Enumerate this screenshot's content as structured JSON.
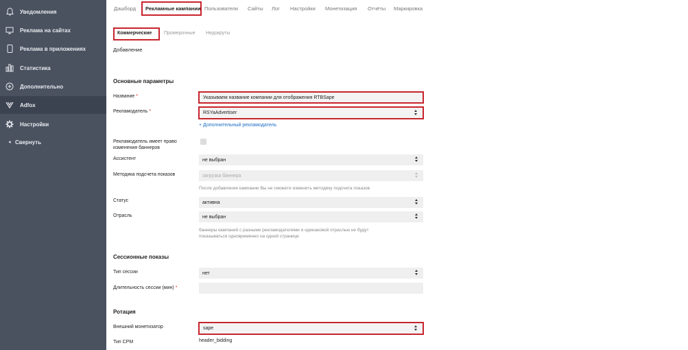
{
  "sidebar": {
    "items": [
      {
        "label": "Уведомления",
        "icon": "bell-icon"
      },
      {
        "label": "Реклама на сайтах",
        "icon": "monitor-icon"
      },
      {
        "label": "Реклама в приложениях",
        "icon": "phone-icon"
      },
      {
        "label": "Статистика",
        "icon": "chart-icon"
      },
      {
        "label": "Дополнительно",
        "icon": "plus-circle-icon"
      },
      {
        "label": "Adfox",
        "icon": "adfox-icon"
      },
      {
        "label": "Настройки",
        "icon": "gear-icon"
      },
      {
        "label": "Свернуть",
        "icon": "collapse-icon"
      }
    ],
    "active_index": 5
  },
  "topnav": {
    "items": [
      "Дашборд",
      "Рекламные кампании",
      "Пользователи",
      "Сайты",
      "Лог",
      "Настройки",
      "Монетизация",
      "Отчёты",
      "Маркировка"
    ],
    "active": "Рекламные кампании"
  },
  "subtabs": {
    "items": [
      "Коммерческие",
      "Промерочные",
      "Недокруты"
    ],
    "active": "Коммерческие"
  },
  "page": {
    "title": "Добавление"
  },
  "basic": {
    "section_title": "Основные параметры",
    "name_label": "Название",
    "name_value": "Указываем название компании для отображения RTBSape",
    "advertiser_label": "Рекламодатель",
    "advertiser_value": "RSYaAdvertiser",
    "add_advertiser_link": "+ Дополнительный рекламодатель",
    "can_change_label_1": "Рекламодатель имеет право",
    "can_change_label_2": "изменения баннеров",
    "assistant_label": "Ассистент",
    "assistant_value": "не выбран",
    "method_label": "Методика подсчета показов",
    "method_value": "загрузка баннера",
    "method_hint": "После добавления кампании Вы не сможете изменить методику подсчета показов",
    "status_label": "Статус",
    "status_value": "активна",
    "industry_label": "Отрасль",
    "industry_value": "не выбран",
    "industry_hint_1": "баннеры кампаний с разными рекламодателями и одинаковой отраслью не будут",
    "industry_hint_2": "показываться одновременно на одной странице"
  },
  "session": {
    "section_title": "Сессионные показы",
    "type_label": "Тип сессии",
    "type_value": "нет",
    "duration_label": "Длительность сессии (мин)",
    "duration_value": ""
  },
  "rotation": {
    "section_title": "Ротация",
    "monetizer_label": "Внешний монетизатор",
    "monetizer_value": "sape",
    "cpm_label": "Тип CPM",
    "cpm_value": "header_bidding"
  },
  "required_mark": "*",
  "colors": {
    "sidebar_bg": "#4a5260",
    "highlight": "#c8232c",
    "link": "#1a6cc4",
    "required": "#d52e2e"
  }
}
